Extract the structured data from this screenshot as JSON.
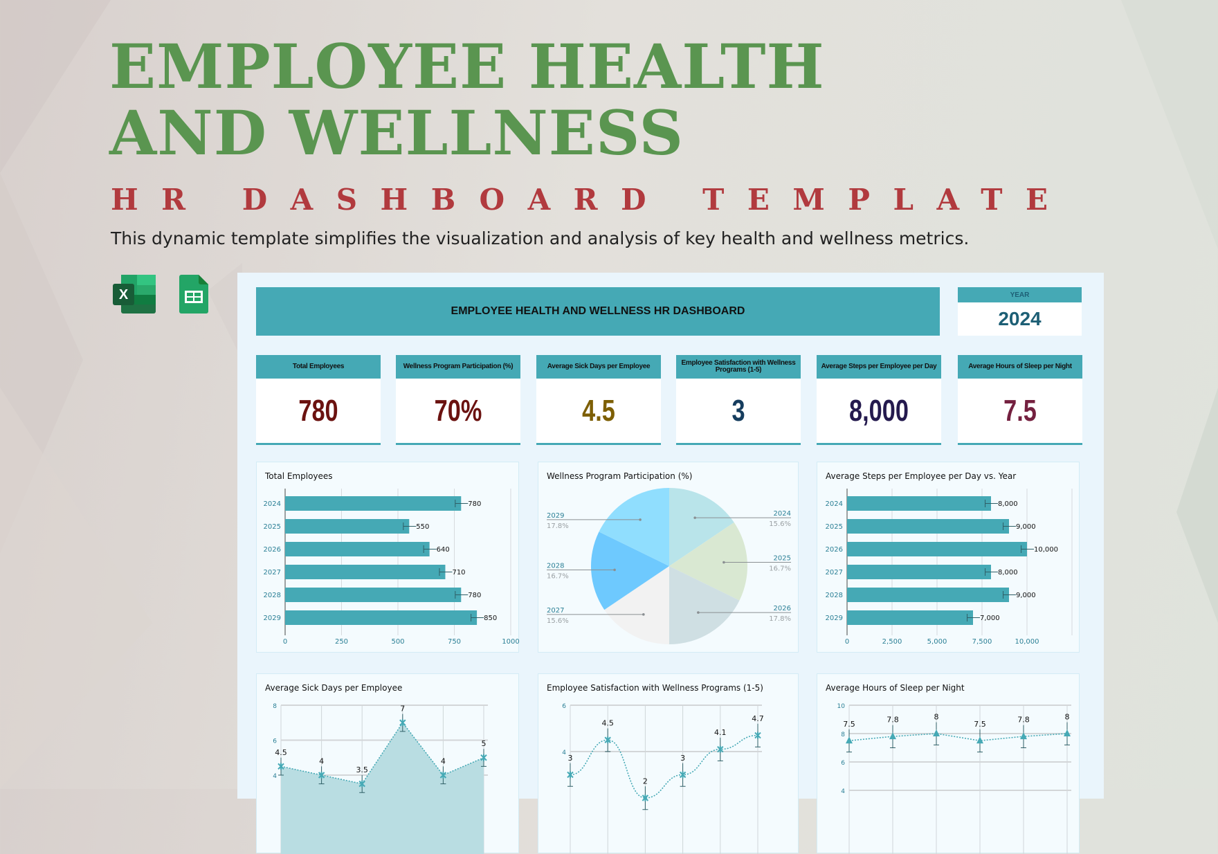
{
  "header": {
    "title_line1": "EMPLOYEE HEALTH",
    "title_line2": "AND WELLNESS",
    "subtitle": "HR DASHBOARD TEMPLATE",
    "description": "This dynamic template simplifies the visualization and analysis of key health and wellness metrics."
  },
  "apps": [
    {
      "name": "excel-icon",
      "letter": "X"
    },
    {
      "name": "google-sheets-icon"
    }
  ],
  "dashboard": {
    "title": "EMPLOYEE HEALTH AND WELLNESS HR DASHBOARD",
    "year_label": "YEAR",
    "year": "2024",
    "kpis": [
      {
        "label": "Total Employees",
        "value": "780",
        "color": "#6b1210"
      },
      {
        "label": "Wellness Program Participation (%)",
        "value": "70%",
        "color": "#6b1210"
      },
      {
        "label": "Average Sick Days per Employee",
        "value": "4.5",
        "color": "#7d5f05"
      },
      {
        "label": "Employee Satisfaction with Wellness Programs (1-5)",
        "value": "3",
        "color": "#163d5e"
      },
      {
        "label": "Average Steps per Employee per Day",
        "value": "8,000",
        "color": "#241a4e"
      },
      {
        "label": "Average Hours of Sleep per Night",
        "value": "7.5",
        "color": "#74203f"
      }
    ]
  },
  "colors": {
    "teal": "#45a9b5",
    "title_green": "#5a9550",
    "subtitle_red": "#b13a3e",
    "axis_label": "#2a7f95"
  },
  "chart_data": [
    {
      "type": "bar",
      "orientation": "horizontal",
      "title": "Total Employees",
      "categories": [
        "2024",
        "2025",
        "2026",
        "2027",
        "2028",
        "2029"
      ],
      "values": [
        780,
        550,
        640,
        710,
        780,
        850
      ],
      "data_labels": [
        "780",
        "550",
        "640",
        "710",
        "780",
        "850"
      ],
      "xlim": [
        0,
        1000
      ],
      "xticks": [
        "0",
        "250",
        "500",
        "750",
        "1000"
      ],
      "error_bars": true,
      "grid": true
    },
    {
      "type": "pie",
      "title": "Wellness Program Participation (%)",
      "categories": [
        "2024",
        "2025",
        "2026",
        "2027",
        "2028",
        "2029"
      ],
      "values": [
        15.6,
        16.7,
        17.8,
        15.6,
        16.7,
        17.8
      ],
      "data_labels": [
        "15.6%",
        "16.7%",
        "17.8%",
        "15.6%",
        "16.7%",
        "17.8%"
      ],
      "colors": [
        "#b9e4ea",
        "#d9e8d2",
        "#cfdfe3",
        "#f2f2f2",
        "#6ec9fe",
        "#90defe"
      ]
    },
    {
      "type": "bar",
      "orientation": "horizontal",
      "title": "Average Steps per Employee per Day vs. Year",
      "categories": [
        "2024",
        "2025",
        "2026",
        "2027",
        "2028",
        "2029"
      ],
      "values": [
        8000,
        9000,
        10000,
        8000,
        9000,
        7000
      ],
      "data_labels": [
        "8,000",
        "9,000",
        "10,000",
        "8,000",
        "9,000",
        "7,000"
      ],
      "xlim": [
        0,
        12500
      ],
      "xticks": [
        "0",
        "2,500",
        "5,000",
        "7,500",
        "10,000"
      ],
      "error_bars": true,
      "grid": true
    },
    {
      "type": "area",
      "title": "Average Sick Days per Employee",
      "values": [
        4.5,
        4,
        3.5,
        7,
        4,
        5
      ],
      "data_labels": [
        "4.5",
        "4",
        "3.5",
        "7",
        "4",
        "5"
      ],
      "ylim": [
        2,
        8
      ],
      "yticks": [
        "8",
        "6",
        "4"
      ],
      "error_bars": true,
      "grid": true
    },
    {
      "type": "line",
      "title": "Employee Satisfaction with Wellness Programs (1-5)",
      "values": [
        3,
        4.5,
        2,
        3,
        4.1,
        4.7
      ],
      "data_labels": [
        "3",
        "4.5",
        "2",
        "3",
        "4.1",
        "4.7"
      ],
      "ylim": [
        0,
        6
      ],
      "yticks": [
        "6",
        "4"
      ],
      "smooth": true,
      "error_bars": true,
      "grid": true
    },
    {
      "type": "line",
      "title": "Average Hours of Sleep per Night",
      "values": [
        7.5,
        7.8,
        8,
        7.5,
        7.8,
        8
      ],
      "data_labels": [
        "7.5",
        "7.8",
        "8",
        "7.5",
        "7.8",
        "8"
      ],
      "ylim": [
        4,
        10
      ],
      "yticks": [
        "10",
        "8",
        "6",
        "4"
      ],
      "marker": "triangle",
      "error_bars": true,
      "grid": true
    }
  ]
}
